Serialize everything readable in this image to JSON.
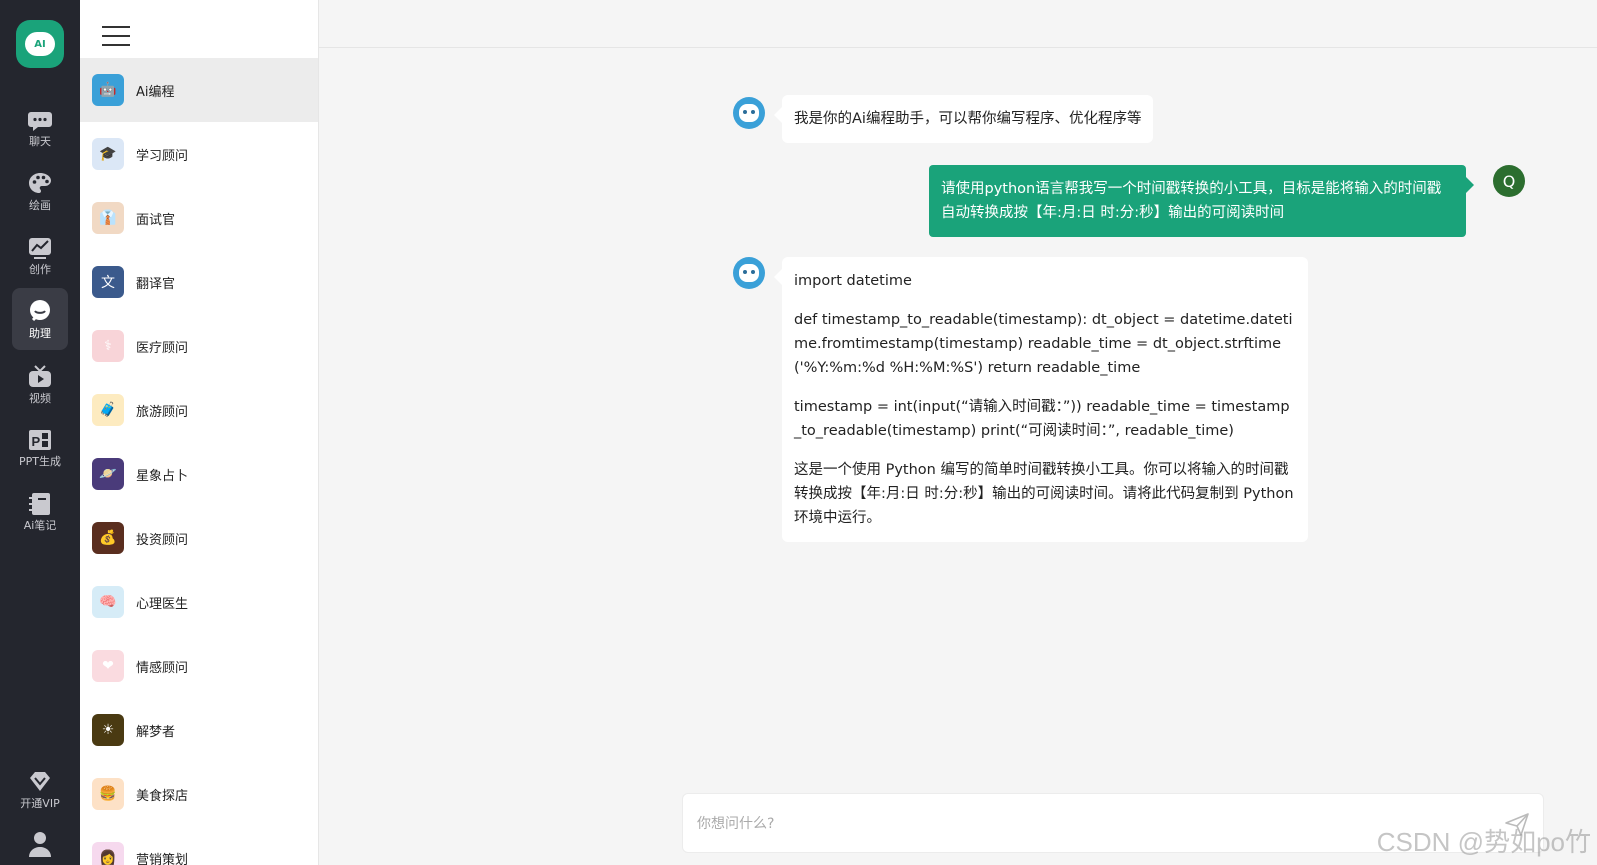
{
  "rail": {
    "logo_text": "AI",
    "items": [
      {
        "label": "聊天",
        "icon": "chat-icon"
      },
      {
        "label": "绘画",
        "icon": "palette-icon"
      },
      {
        "label": "创作",
        "icon": "chart-icon"
      },
      {
        "label": "助理",
        "icon": "assistant-icon"
      },
      {
        "label": "视频",
        "icon": "tv-icon"
      },
      {
        "label": "PPT生成",
        "icon": "ppt-icon"
      },
      {
        "label": "Ai笔记",
        "icon": "notebook-icon"
      }
    ],
    "vip_label": "开通VIP"
  },
  "assistants": [
    {
      "name": "Ai编程",
      "color": "#3aa0d8",
      "glyph": "🤖"
    },
    {
      "name": "学习顾问",
      "color": "#dbe7f6",
      "glyph": "🎓"
    },
    {
      "name": "面试官",
      "color": "#f1d9c4",
      "glyph": "👔"
    },
    {
      "name": "翻译官",
      "color": "#3b5a8c",
      "glyph": "文"
    },
    {
      "name": "医疗顾问",
      "color": "#f8d4d8",
      "glyph": "⚕"
    },
    {
      "name": "旅游顾问",
      "color": "#fdebc0",
      "glyph": "🧳"
    },
    {
      "name": "星象占卜",
      "color": "#4a3b7a",
      "glyph": "🪐"
    },
    {
      "name": "投资顾问",
      "color": "#5a2e1f",
      "glyph": "💰"
    },
    {
      "name": "心理医生",
      "color": "#d6ecf7",
      "glyph": "🧠"
    },
    {
      "name": "情感顾问",
      "color": "#fadbe0",
      "glyph": "❤"
    },
    {
      "name": "解梦者",
      "color": "#4a3a12",
      "glyph": "☀"
    },
    {
      "name": "美食探店",
      "color": "#fde1c6",
      "glyph": "🍔"
    },
    {
      "name": "营销策划",
      "color": "#f6d9ee",
      "glyph": "👩"
    }
  ],
  "chat": {
    "greeting": "我是你的Ai编程助手，可以帮你编写程序、优化程序等",
    "user_message": "请使用python语言帮我写一个时间戳转换的小工具，目标是能将输入的时间戳自动转换成按【年:月:日 时:分:秒】输出的可阅读时间",
    "user_avatar_letter": "Q",
    "reply_paragraphs": [
      "import datetime",
      "def timestamp_to_readable(timestamp): dt_object = datetime.datetime.fromtimestamp(timestamp) readable_time = dt_object.strftime('%Y:%m:%d %H:%M:%S') return readable_time",
      "timestamp = int(input(“请输入时间戳：”)) readable_time = timestamp_to_readable(timestamp) print(“可阅读时间：”, readable_time)",
      "这是一个使用 Python 编写的简单时间戳转换小工具。你可以将输入的时间戳转换成按【年:月:日 时:分:秒】输出的可阅读时间。请将此代码复制到 Python 环境中运行。"
    ]
  },
  "composer": {
    "placeholder": "你想问什么?"
  },
  "watermark": "CSDN @势如po竹",
  "colors": {
    "accent": "#1aa37a",
    "rail": "#24262e"
  }
}
